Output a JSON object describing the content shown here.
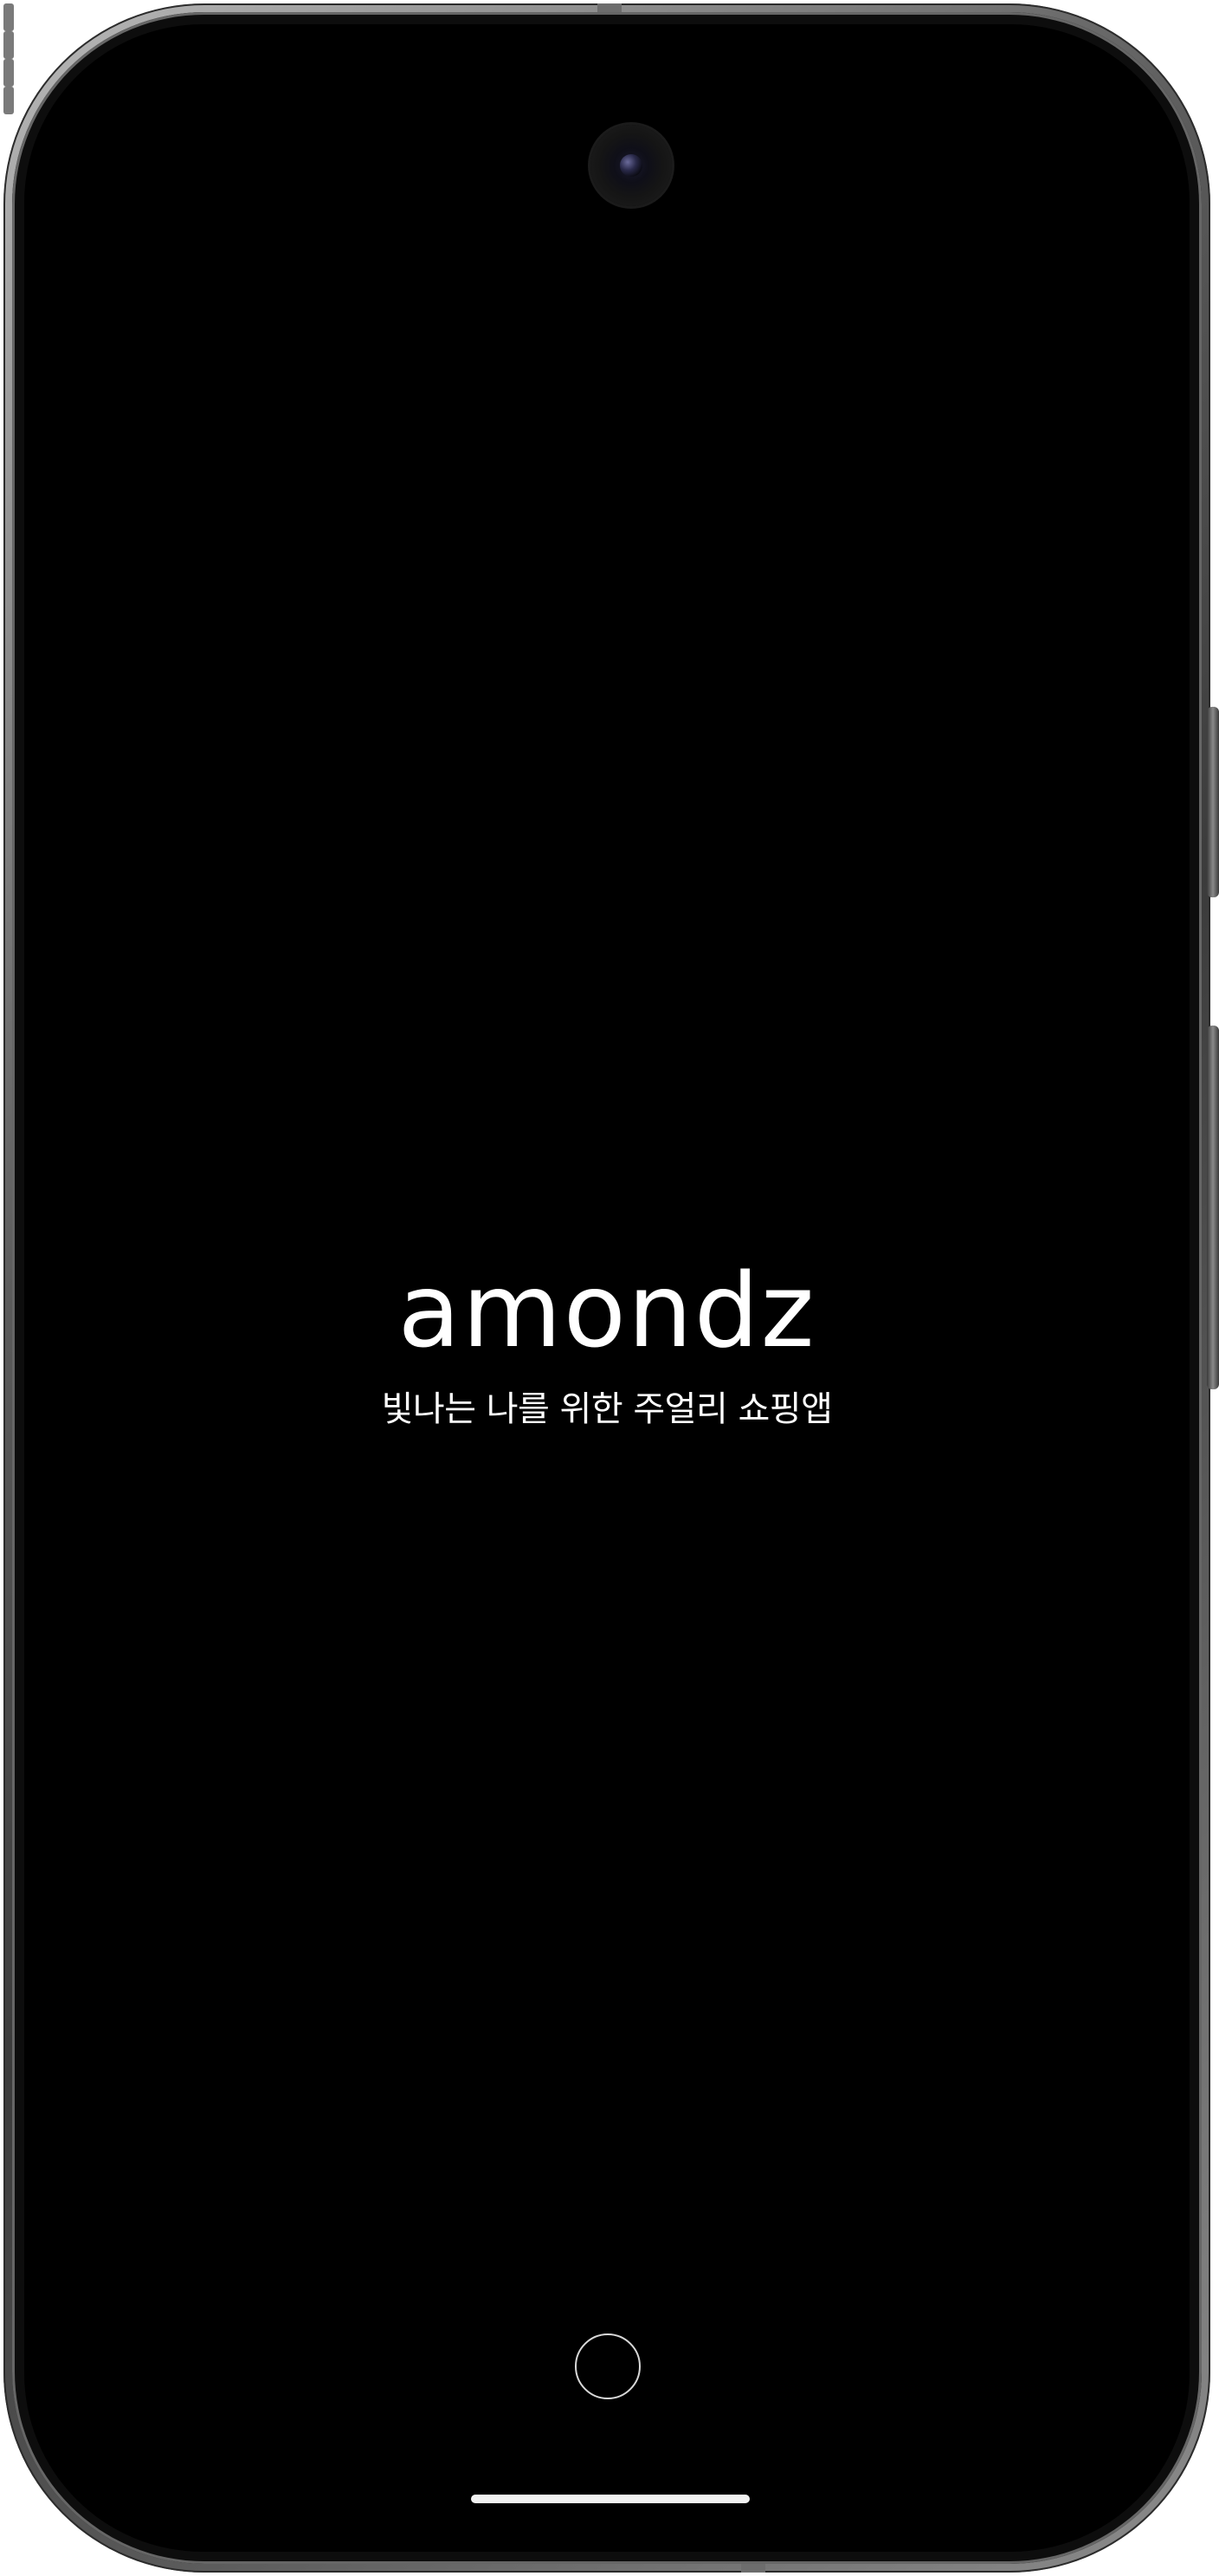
{
  "app": {
    "logo_text": "amondz",
    "tagline": "빛나는 나를 위한 주얼리 쇼핑앱"
  },
  "device": {
    "icons": [
      "front-camera-icon",
      "home-circle-icon",
      "home-indicator-bar"
    ]
  },
  "colors": {
    "background": "#000000",
    "text": "#ffffff",
    "frame": "#5a5a5a"
  }
}
